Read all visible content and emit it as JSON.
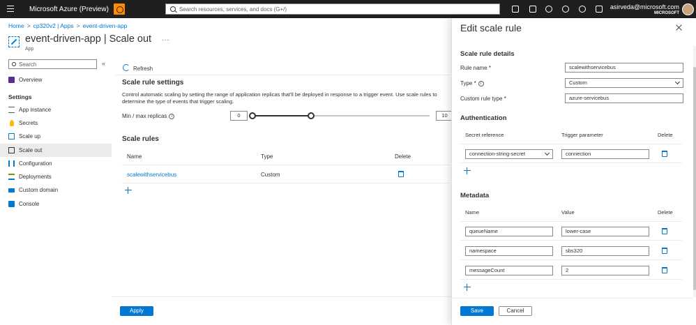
{
  "topbar": {
    "title": "Microsoft Azure (Preview)",
    "search_placeholder": "Search resources, services, and docs (G+/)",
    "account_email": "asirveda@microsoft.com",
    "account_org": "MICROSOFT",
    "bg_color": "#1f1f1f"
  },
  "breadcrumb": [
    "Home",
    "cp320v2 | Apps",
    "event-driven-app"
  ],
  "header": {
    "resource_name": "event-driven-app",
    "page_name": "Scale out",
    "pipe": "|",
    "subtitle": "App",
    "more": "..."
  },
  "sidebar": {
    "search_placeholder": "Search",
    "collapse": "«",
    "overview": "Overview",
    "settings_heading": "Settings",
    "items": [
      {
        "label": "App instance",
        "icon": "list-icon"
      },
      {
        "label": "Secrets",
        "icon": "key-icon"
      },
      {
        "label": "Scale up",
        "icon": "scale-up-icon"
      },
      {
        "label": "Scale out",
        "icon": "scale-out-icon",
        "selected": true
      },
      {
        "label": "Configuration",
        "icon": "configuration-icon"
      },
      {
        "label": "Deployments",
        "icon": "deployments-icon"
      },
      {
        "label": "Custom domain",
        "icon": "domain-icon"
      },
      {
        "label": "Console",
        "icon": "console-icon"
      }
    ]
  },
  "main": {
    "refresh_label": "Refresh",
    "settings_title": "Scale rule settings",
    "description": "Control automatic scaling by setting the range of application replicas that'll be deployed in response to a trigger event. Use scale rules to determine the type of events that trigger scaling.",
    "minmax_label": "Min / max replicas",
    "min_replicas": "0",
    "max_replicas": "10",
    "slider_min_fraction": 0,
    "slider_max_fraction": 0.33,
    "rules_title": "Scale rules",
    "columns": {
      "name": "Name",
      "type": "Type",
      "delete": "Delete"
    },
    "rules": [
      {
        "name": "scalewithservicebus",
        "type": "Custom"
      }
    ],
    "apply_label": "Apply"
  },
  "panel": {
    "title": "Edit scale rule",
    "details_heading": "Scale rule details",
    "rule_name_label": "Rule name *",
    "rule_name_value": "scalewithservicebus",
    "type_label": "Type *",
    "type_value": "Custom",
    "custom_type_label": "Custom rule type *",
    "custom_type_value": "azure-servicebus",
    "auth_heading": "Authentication",
    "auth_columns": {
      "secret": "Secret reference",
      "trigger": "Trigger parameter",
      "delete": "Delete"
    },
    "auth_rows": [
      {
        "secret": "connection-string-secret",
        "trigger": "connection"
      }
    ],
    "metadata_heading": "Metadata",
    "metadata_columns": {
      "name": "Name",
      "value": "Value",
      "delete": "Delete"
    },
    "metadata_rows": [
      {
        "name": "queueName",
        "value": "lower-case"
      },
      {
        "name": "namespace",
        "value": "sbs320"
      },
      {
        "name": "messageCount",
        "value": "2"
      }
    ],
    "save_label": "Save",
    "cancel_label": "Cancel"
  },
  "colors": {
    "accent": "#0078d4",
    "brand_icon": "#ff8c00"
  }
}
